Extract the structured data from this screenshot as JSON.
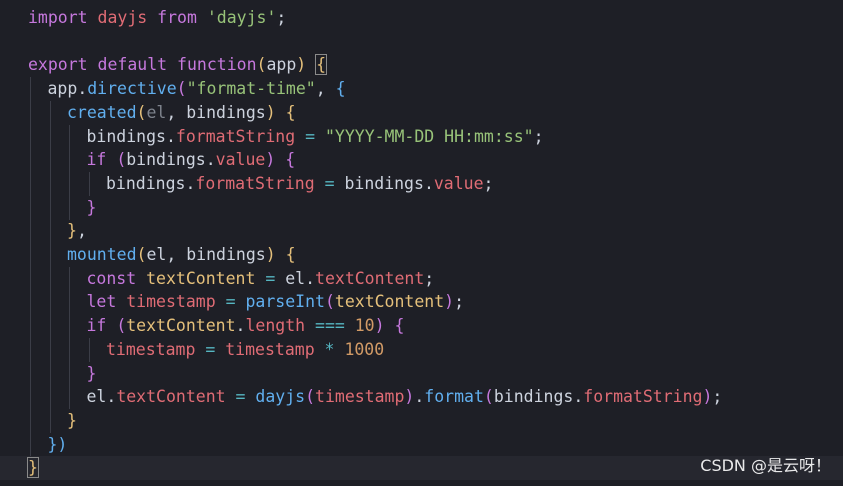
{
  "colors": {
    "background": "#1e1f26",
    "active_line": "#26272f",
    "keyword": "#c678dd",
    "default": "#cdd3de",
    "variable": "#e06c75",
    "function": "#61afef",
    "string": "#98c379",
    "number": "#d19a66",
    "operator": "#56b6c2",
    "paren": "#c678dd",
    "brace_gold": "#e5c07b"
  },
  "code_lines": [
    {
      "indent": 0,
      "tokens": [
        {
          "t": "import",
          "c": "#c678dd"
        },
        {
          "t": " dayjs ",
          "c": "#e06c75"
        },
        {
          "t": "from",
          "c": "#c678dd"
        },
        {
          "t": " ",
          "c": "#cdd3de"
        },
        {
          "t": "'dayjs'",
          "c": "#98c379"
        },
        {
          "t": ";",
          "c": "#cdd3de"
        }
      ]
    },
    {
      "indent": 0,
      "tokens": []
    },
    {
      "indent": 0,
      "tokens": [
        {
          "t": "export",
          "c": "#c678dd"
        },
        {
          "t": " ",
          "c": "#cdd3de"
        },
        {
          "t": "default",
          "c": "#c678dd"
        },
        {
          "t": " ",
          "c": "#cdd3de"
        },
        {
          "t": "function",
          "c": "#c678dd"
        },
        {
          "t": "(",
          "c": "#e5c07b"
        },
        {
          "t": "app",
          "c": "#cdd3de"
        },
        {
          "t": ")",
          "c": "#e5c07b"
        },
        {
          "t": " ",
          "c": "#cdd3de"
        },
        {
          "t": "{",
          "c": "#e5c07b",
          "hl": true
        }
      ]
    },
    {
      "indent": 1,
      "tokens": [
        {
          "t": "app",
          "c": "#cdd3de"
        },
        {
          "t": ".",
          "c": "#cdd3de"
        },
        {
          "t": "directive",
          "c": "#61afef"
        },
        {
          "t": "(",
          "c": "#c678dd"
        },
        {
          "t": "\"format-time\"",
          "c": "#98c379"
        },
        {
          "t": ", ",
          "c": "#cdd3de"
        },
        {
          "t": "{",
          "c": "#61afef"
        }
      ]
    },
    {
      "indent": 2,
      "tokens": [
        {
          "t": "created",
          "c": "#61afef"
        },
        {
          "t": "(",
          "c": "#e5c07b"
        },
        {
          "t": "el",
          "c": "#7f848e"
        },
        {
          "t": ", bindings",
          "c": "#cdd3de"
        },
        {
          "t": ")",
          "c": "#e5c07b"
        },
        {
          "t": " ",
          "c": "#cdd3de"
        },
        {
          "t": "{",
          "c": "#e5c07b"
        }
      ]
    },
    {
      "indent": 3,
      "tokens": [
        {
          "t": "bindings",
          "c": "#cdd3de"
        },
        {
          "t": ".",
          "c": "#cdd3de"
        },
        {
          "t": "formatString",
          "c": "#e06c75"
        },
        {
          "t": " = ",
          "c": "#56b6c2"
        },
        {
          "t": "\"YYYY-MM-DD HH:mm:ss\"",
          "c": "#98c379"
        },
        {
          "t": ";",
          "c": "#cdd3de"
        }
      ]
    },
    {
      "indent": 3,
      "tokens": [
        {
          "t": "if",
          "c": "#c678dd"
        },
        {
          "t": " ",
          "c": "#cdd3de"
        },
        {
          "t": "(",
          "c": "#c678dd"
        },
        {
          "t": "bindings",
          "c": "#cdd3de"
        },
        {
          "t": ".",
          "c": "#cdd3de"
        },
        {
          "t": "value",
          "c": "#e06c75"
        },
        {
          "t": ")",
          "c": "#c678dd"
        },
        {
          "t": " ",
          "c": "#cdd3de"
        },
        {
          "t": "{",
          "c": "#c678dd"
        }
      ]
    },
    {
      "indent": 4,
      "tokens": [
        {
          "t": "bindings",
          "c": "#cdd3de"
        },
        {
          "t": ".",
          "c": "#cdd3de"
        },
        {
          "t": "formatString",
          "c": "#e06c75"
        },
        {
          "t": " = ",
          "c": "#56b6c2"
        },
        {
          "t": "bindings",
          "c": "#cdd3de"
        },
        {
          "t": ".",
          "c": "#cdd3de"
        },
        {
          "t": "value",
          "c": "#e06c75"
        },
        {
          "t": ";",
          "c": "#cdd3de"
        }
      ]
    },
    {
      "indent": 3,
      "tokens": [
        {
          "t": "}",
          "c": "#c678dd"
        }
      ]
    },
    {
      "indent": 2,
      "tokens": [
        {
          "t": "}",
          "c": "#e5c07b"
        },
        {
          "t": ",",
          "c": "#cdd3de"
        }
      ]
    },
    {
      "indent": 2,
      "tokens": [
        {
          "t": "mounted",
          "c": "#61afef"
        },
        {
          "t": "(",
          "c": "#e5c07b"
        },
        {
          "t": "el, bindings",
          "c": "#cdd3de"
        },
        {
          "t": ")",
          "c": "#e5c07b"
        },
        {
          "t": " ",
          "c": "#cdd3de"
        },
        {
          "t": "{",
          "c": "#e5c07b"
        }
      ]
    },
    {
      "indent": 3,
      "tokens": [
        {
          "t": "const",
          "c": "#c678dd"
        },
        {
          "t": " ",
          "c": "#cdd3de"
        },
        {
          "t": "textContent",
          "c": "#e5c07b"
        },
        {
          "t": " = ",
          "c": "#56b6c2"
        },
        {
          "t": "el",
          "c": "#cdd3de"
        },
        {
          "t": ".",
          "c": "#cdd3de"
        },
        {
          "t": "textContent",
          "c": "#e06c75"
        },
        {
          "t": ";",
          "c": "#cdd3de"
        }
      ]
    },
    {
      "indent": 3,
      "tokens": [
        {
          "t": "let",
          "c": "#c678dd"
        },
        {
          "t": " ",
          "c": "#cdd3de"
        },
        {
          "t": "timestamp",
          "c": "#e06c75"
        },
        {
          "t": " = ",
          "c": "#56b6c2"
        },
        {
          "t": "parseInt",
          "c": "#61afef"
        },
        {
          "t": "(",
          "c": "#c678dd"
        },
        {
          "t": "textContent",
          "c": "#e5c07b"
        },
        {
          "t": ")",
          "c": "#c678dd"
        },
        {
          "t": ";",
          "c": "#cdd3de"
        }
      ]
    },
    {
      "indent": 3,
      "tokens": [
        {
          "t": "if",
          "c": "#c678dd"
        },
        {
          "t": " ",
          "c": "#cdd3de"
        },
        {
          "t": "(",
          "c": "#c678dd"
        },
        {
          "t": "textContent",
          "c": "#e5c07b"
        },
        {
          "t": ".",
          "c": "#cdd3de"
        },
        {
          "t": "length",
          "c": "#e06c75"
        },
        {
          "t": " === ",
          "c": "#56b6c2"
        },
        {
          "t": "10",
          "c": "#d19a66"
        },
        {
          "t": ")",
          "c": "#c678dd"
        },
        {
          "t": " ",
          "c": "#cdd3de"
        },
        {
          "t": "{",
          "c": "#c678dd"
        }
      ]
    },
    {
      "indent": 4,
      "tokens": [
        {
          "t": "timestamp",
          "c": "#e06c75"
        },
        {
          "t": " = ",
          "c": "#56b6c2"
        },
        {
          "t": "timestamp",
          "c": "#e06c75"
        },
        {
          "t": " * ",
          "c": "#56b6c2"
        },
        {
          "t": "1000",
          "c": "#d19a66"
        }
      ]
    },
    {
      "indent": 3,
      "tokens": [
        {
          "t": "}",
          "c": "#c678dd"
        }
      ]
    },
    {
      "indent": 3,
      "tokens": [
        {
          "t": "el",
          "c": "#cdd3de"
        },
        {
          "t": ".",
          "c": "#cdd3de"
        },
        {
          "t": "textContent",
          "c": "#e06c75"
        },
        {
          "t": " = ",
          "c": "#56b6c2"
        },
        {
          "t": "dayjs",
          "c": "#61afef"
        },
        {
          "t": "(",
          "c": "#c678dd"
        },
        {
          "t": "timestamp",
          "c": "#e06c75"
        },
        {
          "t": ")",
          "c": "#c678dd"
        },
        {
          "t": ".",
          "c": "#cdd3de"
        },
        {
          "t": "format",
          "c": "#61afef"
        },
        {
          "t": "(",
          "c": "#c678dd"
        },
        {
          "t": "bindings",
          "c": "#cdd3de"
        },
        {
          "t": ".",
          "c": "#cdd3de"
        },
        {
          "t": "formatString",
          "c": "#e06c75"
        },
        {
          "t": ")",
          "c": "#c678dd"
        },
        {
          "t": ";",
          "c": "#cdd3de"
        }
      ]
    },
    {
      "indent": 2,
      "tokens": [
        {
          "t": "}",
          "c": "#e5c07b"
        }
      ]
    },
    {
      "indent": 1,
      "tokens": [
        {
          "t": "})",
          "c": "#61afef"
        }
      ]
    },
    {
      "indent": 0,
      "active": true,
      "tokens": [
        {
          "t": "}",
          "c": "#e5c07b",
          "hl": true
        }
      ]
    }
  ],
  "watermark": "CSDN @是云呀！"
}
